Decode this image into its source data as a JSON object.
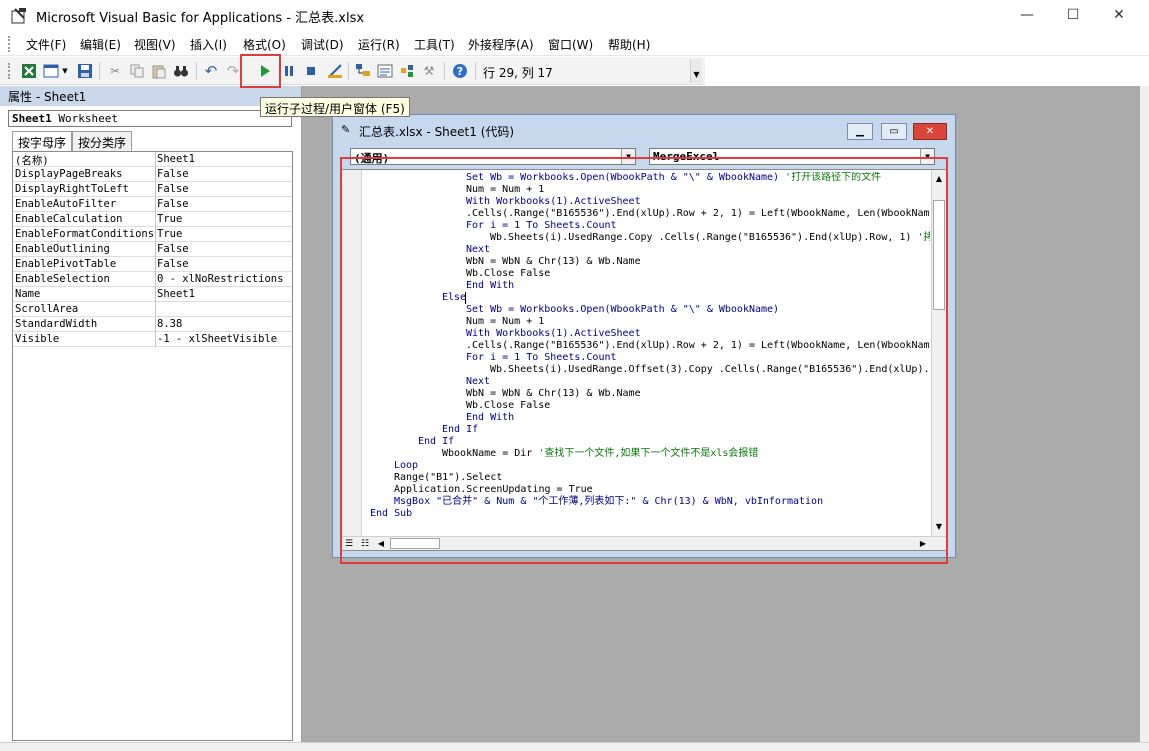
{
  "window": {
    "title": "Microsoft Visual Basic for Applications - 汇总表.xlsx",
    "minimize": "—",
    "maximize": "☐",
    "close": "✕"
  },
  "menu": [
    "文件(F)",
    "编辑(E)",
    "视图(V)",
    "插入(I)",
    "格式(O)",
    "调试(D)",
    "运行(R)",
    "工具(T)",
    "外接程序(A)",
    "窗口(W)",
    "帮助(H)"
  ],
  "toolbar": {
    "position": "行 29, 列 17",
    "run_tooltip": "运行子过程/用户窗体 (F5)"
  },
  "properties": {
    "header": "属性 - Sheet1",
    "object_name": "Sheet1",
    "object_type": "Worksheet",
    "tabs": [
      "按字母序",
      "按分类序"
    ],
    "rows": [
      {
        "name": "(名称)",
        "value": "Sheet1"
      },
      {
        "name": "DisplayPageBreaks",
        "value": "False"
      },
      {
        "name": "DisplayRightToLeft",
        "value": "False"
      },
      {
        "name": "EnableAutoFilter",
        "value": "False"
      },
      {
        "name": "EnableCalculation",
        "value": "True"
      },
      {
        "name": "EnableFormatConditionsC",
        "value": "True"
      },
      {
        "name": "EnableOutlining",
        "value": "False"
      },
      {
        "name": "EnablePivotTable",
        "value": "False"
      },
      {
        "name": "EnableSelection",
        "value": "0 - xlNoRestrictions"
      },
      {
        "name": "Name",
        "value": "Sheet1"
      },
      {
        "name": "ScrollArea",
        "value": ""
      },
      {
        "name": "StandardWidth",
        "value": "8.38"
      },
      {
        "name": "Visible",
        "value": "-1 - xlSheetVisible"
      }
    ]
  },
  "code_window": {
    "title": "汇总表.xlsx - Sheet1 (代码)",
    "object_combo": "(通用)",
    "proc_combo": "MergeExcel",
    "lines": [
      {
        "indent": 4,
        "code": "Set Wb = Workbooks.Open(WbookPath & \"\\\" & WbookName)",
        "comment": "'打开该路径下的文件"
      },
      {
        "indent": 4,
        "code": "Num = Num + 1",
        "comment": ""
      },
      {
        "indent": 4,
        "code": "With Workbooks(1).ActiveSheet",
        "comment": ""
      },
      {
        "indent": 4,
        "code": ".Cells(.Range(\"B165536\").End(xlUp).Row + 2, 1) = Left(WbookName, Len(WbookName",
        "comment": ""
      },
      {
        "indent": 4,
        "code": "For i = 1 To Sheets.Count",
        "comment": ""
      },
      {
        "indent": 5,
        "code": "Wb.Sheets(i).UsedRange.Copy .Cells(.Range(\"B165536\").End(xlUp).Row, 1)",
        "comment": "'拷"
      },
      {
        "indent": 4,
        "code": "Next",
        "comment": ""
      },
      {
        "indent": 4,
        "code": "WbN = WbN & Chr(13) & Wb.Name",
        "comment": ""
      },
      {
        "indent": 4,
        "code": "Wb.Close False",
        "comment": ""
      },
      {
        "indent": 4,
        "code": "End With",
        "comment": ""
      },
      {
        "indent": 3,
        "code": "Else",
        "comment": ""
      },
      {
        "indent": 4,
        "code": "Set Wb = Workbooks.Open(WbookPath & \"\\\" & WbookName)",
        "comment": ""
      },
      {
        "indent": 4,
        "code": "Num = Num + 1",
        "comment": ""
      },
      {
        "indent": 4,
        "code": "With Workbooks(1).ActiveSheet",
        "comment": ""
      },
      {
        "indent": 4,
        "code": ".Cells(.Range(\"B165536\").End(xlUp).Row + 2, 1) = Left(WbookName, Len(WbookName",
        "comment": ""
      },
      {
        "indent": 4,
        "code": "For i = 1 To Sheets.Count",
        "comment": ""
      },
      {
        "indent": 5,
        "code": "Wb.Sheets(i).UsedRange.Offset(3).Copy .Cells(.Range(\"B165536\").End(xlUp).",
        "comment": ""
      },
      {
        "indent": 4,
        "code": "Next",
        "comment": ""
      },
      {
        "indent": 4,
        "code": "WbN = WbN & Chr(13) & Wb.Name",
        "comment": ""
      },
      {
        "indent": 4,
        "code": "Wb.Close False",
        "comment": ""
      },
      {
        "indent": 4,
        "code": "End With",
        "comment": ""
      },
      {
        "indent": 3,
        "code": "End If",
        "comment": ""
      },
      {
        "indent": 2,
        "code": "End If",
        "comment": ""
      },
      {
        "indent": 3,
        "code": "WbookName = Dir",
        "comment": "'查找下一个文件,如果下一个文件不是xls会报错"
      },
      {
        "indent": 1,
        "code": "Loop",
        "comment": ""
      },
      {
        "indent": 1,
        "code": "Range(\"B1\").Select",
        "comment": ""
      },
      {
        "indent": 1,
        "code": "Application.ScreenUpdating = True",
        "comment": ""
      },
      {
        "indent": 1,
        "code": "MsgBox \"已合并\" & Num & \"个工作薄,列表如下:\" & Chr(13) & WbN, vbInformation",
        "comment": ""
      },
      {
        "indent": 0,
        "code": "End Sub",
        "comment": ""
      }
    ]
  },
  "colors": {
    "highlight": "#e03c3c",
    "keyword": "#00008b",
    "comment": "#0a7a0a"
  }
}
